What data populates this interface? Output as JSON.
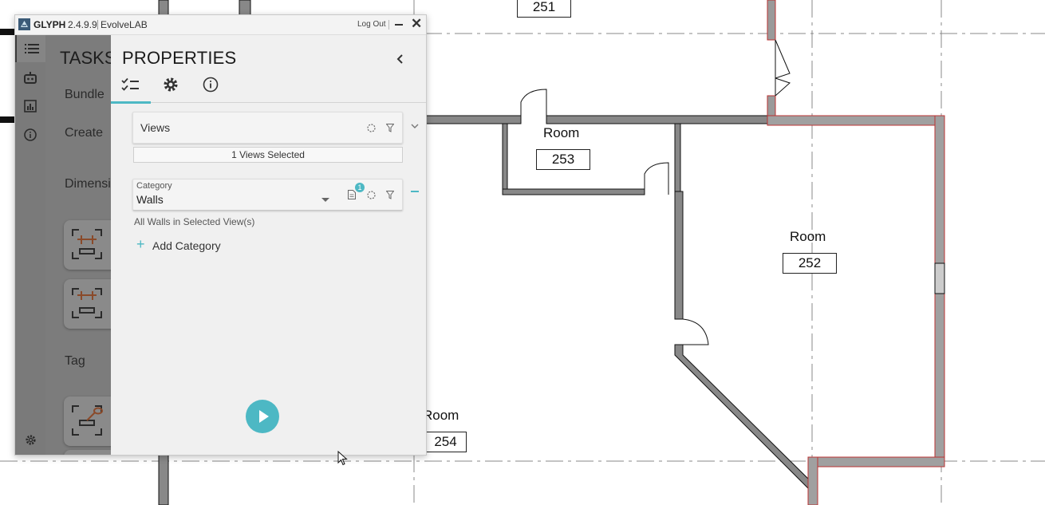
{
  "window": {
    "app_name": "GLYPH",
    "version": "2.4.9.9",
    "company": "EvolveLAB",
    "logout_label": "Log Out",
    "close_label": "✕"
  },
  "left_rail": {
    "items": [
      {
        "icon": "list-icon",
        "active": true
      },
      {
        "icon": "robot-icon",
        "active": false
      },
      {
        "icon": "bar-chart-icon",
        "active": false
      },
      {
        "icon": "info-icon",
        "active": false
      }
    ],
    "bottom_icon": "gear-icon"
  },
  "tasks": {
    "title": "TASKS",
    "items": [
      "Bundle",
      "Create",
      "Dimensi",
      "Tag"
    ]
  },
  "properties": {
    "title": "PROPERTIES",
    "tabs": [
      {
        "icon": "checklist-icon",
        "active": true
      },
      {
        "icon": "gear-icon",
        "active": false
      },
      {
        "icon": "info-icon",
        "active": false
      }
    ],
    "views": {
      "label": "Views",
      "selected_text": "1 Views Selected"
    },
    "category": {
      "caption": "Category",
      "value": "Walls",
      "badge_count": "1",
      "description": "All Walls in Selected View(s)"
    },
    "add_category_label": "Add Category",
    "accent_color": "#4db8c4"
  },
  "plan": {
    "rooms": [
      {
        "label": "",
        "number": "251"
      },
      {
        "label": "Room",
        "number": "253"
      },
      {
        "label": "Room",
        "number": "252"
      },
      {
        "label": "Room",
        "number": "254"
      }
    ]
  }
}
